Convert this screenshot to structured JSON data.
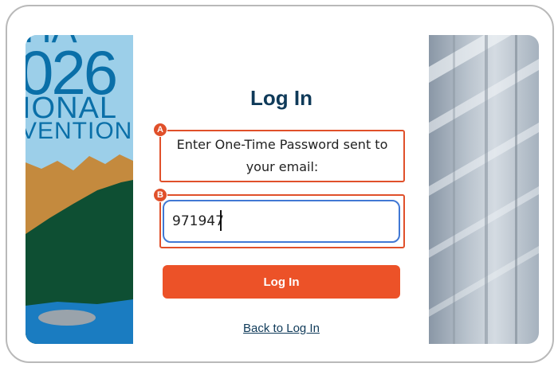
{
  "banner": {
    "year_fragment": "026",
    "line1_fragment": "IONAL",
    "line2_fragment": "VENTION",
    "top_fragment": "HA"
  },
  "form": {
    "title": "Log In",
    "otp_prompt": "Enter One-Time Password sent to your email:",
    "otp_value": "971947",
    "submit_label": "Log In",
    "back_link": "Back to Log In"
  },
  "annotations": {
    "marker_a": "A",
    "marker_b": "B"
  },
  "colors": {
    "accent": "#ec5228",
    "title": "#0f3a59",
    "focus_border": "#4178d4"
  }
}
